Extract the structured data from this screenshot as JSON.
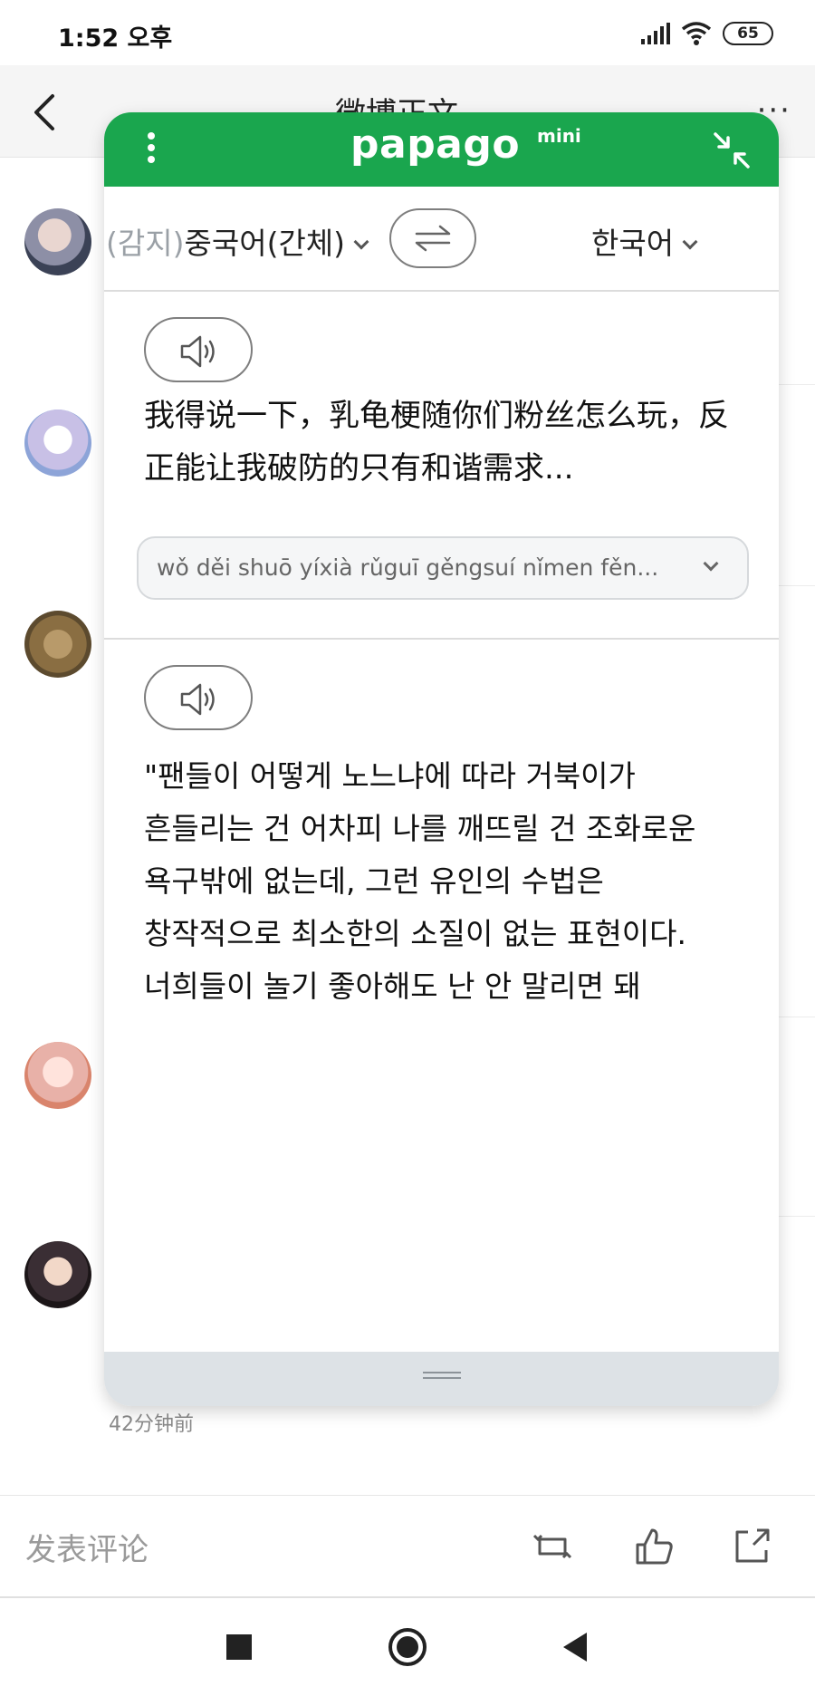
{
  "status_bar": {
    "time": "1:52 오후",
    "battery": "65",
    "icons": [
      "signal-icon",
      "wifi-icon",
      "battery-icon"
    ]
  },
  "weibo": {
    "back_icon": "back-arrow-icon",
    "title": "微博正文",
    "more_label": "···",
    "comment_timestamp": "42分钟前",
    "comment_placeholder": "发表评论",
    "actions": [
      "repost-icon",
      "like-icon",
      "share-icon"
    ]
  },
  "papago": {
    "logo": "papago",
    "logo_suffix": "mini",
    "menu_icon": "kebab-menu-icon",
    "collapse_icon": "collapse-icon",
    "source_lang_detect": "(감지)",
    "source_lang": "중국어(간체)",
    "target_lang": "한국어",
    "swap_icon": "swap-arrows-icon",
    "source_text": "我得说一下，乳龟梗随你们粉丝怎么玩，反正能让我破防的只有和谐需求...",
    "pinyin": "wǒ děi shuō yíxià rǔguī gěngsuí nǐmen fěn...",
    "translation": "\"팬들이 어떻게 노느냐에 따라 거북이가 흔들리는 건 어차피 나를 깨뜨릴 건 조화로운 욕구밖에 없는데, 그런 유인의 수법은 창작적으로 최소한의 소질이 없는 표현이다.너희들이 놀기 좋아해도 난 안 말리면 돼"
  },
  "nav": [
    "recents-icon",
    "home-icon",
    "back-icon"
  ],
  "colors": {
    "papago_green": "#1aa64e",
    "handle_bar": "#dde2e6"
  }
}
